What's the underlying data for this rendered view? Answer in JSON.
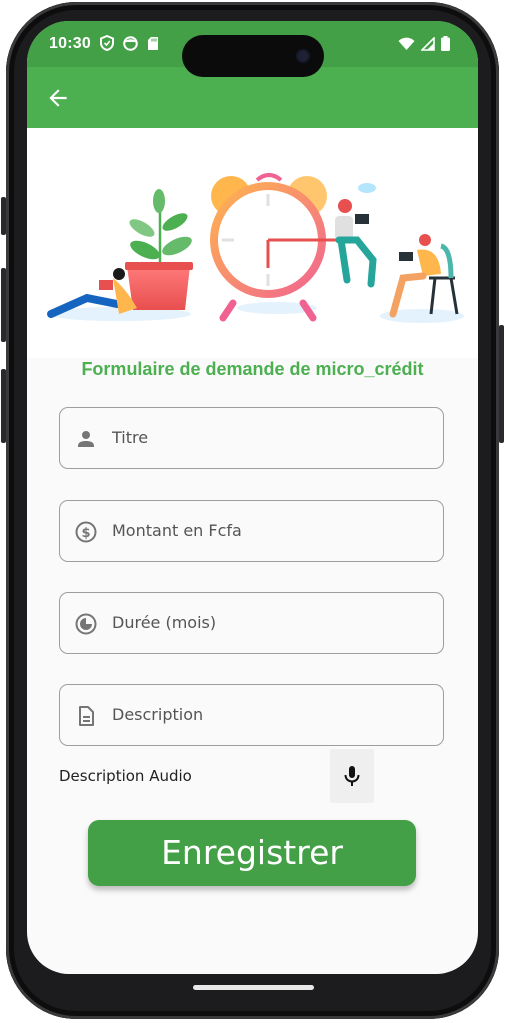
{
  "status_bar": {
    "time": "10:30",
    "left_icons": [
      "shield-icon",
      "face-icon",
      "sd-card-icon"
    ],
    "right_icons": [
      "wifi-icon",
      "signal-icon",
      "battery-icon"
    ]
  },
  "app_bar": {
    "back_icon": "arrow-left-icon",
    "color": "#4caf50"
  },
  "form": {
    "title": "Formulaire de demande de micro_crédit",
    "fields": [
      {
        "icon": "person-icon",
        "placeholder": "Titre"
      },
      {
        "icon": "dollar-circle-icon",
        "placeholder": "Montant en Fcfa"
      },
      {
        "icon": "timelapse-icon",
        "placeholder": "Durée (mois)"
      },
      {
        "icon": "document-icon",
        "placeholder": "Description"
      }
    ],
    "audio_label": "Description Audio",
    "audio_icon": "microphone-icon",
    "save_label": "Enregistrer"
  },
  "colors": {
    "primary": "#4caf50",
    "button": "#43a047",
    "status": "#43a047"
  }
}
